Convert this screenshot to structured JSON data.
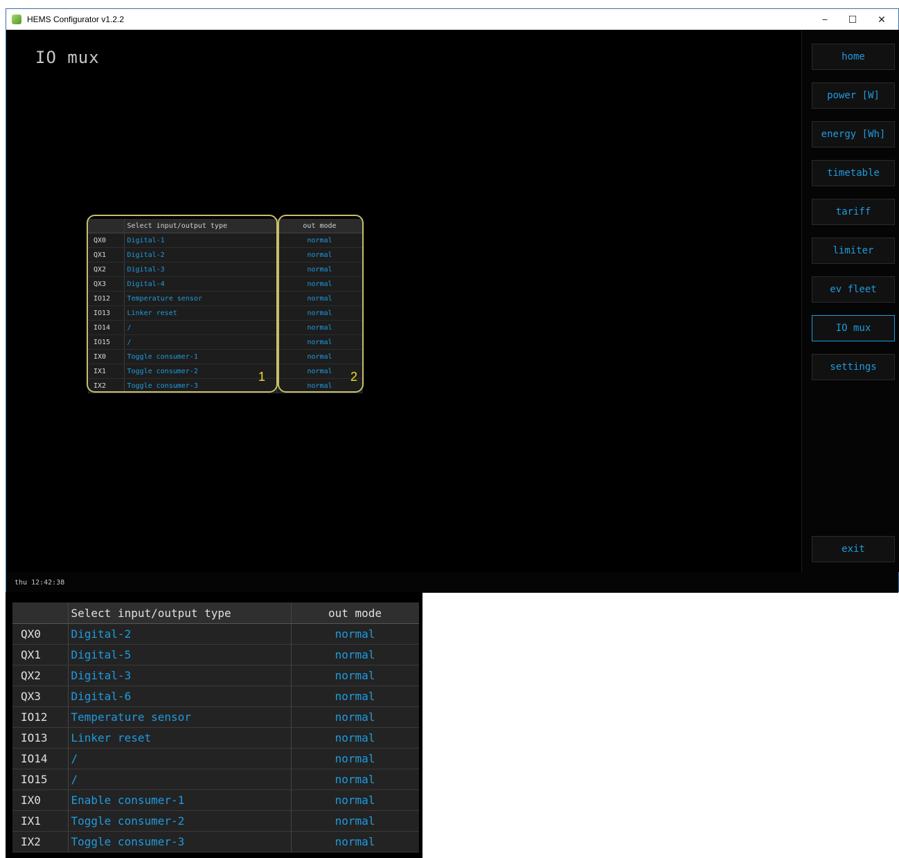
{
  "window": {
    "title": "HEMS Configurator v1.2.2",
    "controls": {
      "minimize": "−",
      "maximize": "☐",
      "close": "✕"
    }
  },
  "page": {
    "title": "IO mux"
  },
  "sidebar": {
    "items": [
      {
        "label": "home",
        "active": false
      },
      {
        "label": "power [W]",
        "active": false
      },
      {
        "label": "energy [Wh]",
        "active": false
      },
      {
        "label": "timetable",
        "active": false
      },
      {
        "label": "tariff",
        "active": false
      },
      {
        "label": "limiter",
        "active": false
      },
      {
        "label": "ev fleet",
        "active": false
      },
      {
        "label": "IO mux",
        "active": true
      },
      {
        "label": "settings",
        "active": false
      }
    ],
    "exit_label": "exit"
  },
  "status": {
    "time": "thu 12:42:38"
  },
  "small_table": {
    "headers": [
      "",
      "Select input/output type",
      "out mode"
    ],
    "rows": [
      {
        "pin": "QX0",
        "type": "Digital-1",
        "mode": "normal"
      },
      {
        "pin": "QX1",
        "type": "Digital-2",
        "mode": "normal"
      },
      {
        "pin": "QX2",
        "type": "Digital-3",
        "mode": "normal"
      },
      {
        "pin": "QX3",
        "type": "Digital-4",
        "mode": "normal"
      },
      {
        "pin": "IO12",
        "type": "Temperature sensor",
        "mode": "normal"
      },
      {
        "pin": "IO13",
        "type": "Linker reset",
        "mode": "normal"
      },
      {
        "pin": "IO14",
        "type": "/",
        "mode": "normal"
      },
      {
        "pin": "IO15",
        "type": "/",
        "mode": "normal"
      },
      {
        "pin": "IX0",
        "type": "Toggle consumer-1",
        "mode": "normal"
      },
      {
        "pin": "IX1",
        "type": "Toggle consumer-2",
        "mode": "normal"
      },
      {
        "pin": "IX2",
        "type": "Toggle consumer-3",
        "mode": "normal"
      }
    ],
    "callouts": [
      "1",
      "2"
    ]
  },
  "big_table": {
    "headers": [
      "",
      "Select input/output type",
      "out mode"
    ],
    "rows": [
      {
        "pin": "QX0",
        "type": "Digital-2",
        "mode": "normal"
      },
      {
        "pin": "QX1",
        "type": "Digital-5",
        "mode": "normal"
      },
      {
        "pin": "QX2",
        "type": "Digital-3",
        "mode": "normal"
      },
      {
        "pin": "QX3",
        "type": "Digital-6",
        "mode": "normal"
      },
      {
        "pin": "IO12",
        "type": "Temperature sensor",
        "mode": "normal"
      },
      {
        "pin": "IO13",
        "type": "Linker reset",
        "mode": "normal"
      },
      {
        "pin": "IO14",
        "type": "/",
        "mode": "normal"
      },
      {
        "pin": "IO15",
        "type": "/",
        "mode": "normal"
      },
      {
        "pin": "IX0",
        "type": "Enable consumer-1",
        "mode": "normal"
      },
      {
        "pin": "IX1",
        "type": "Toggle consumer-2",
        "mode": "normal"
      },
      {
        "pin": "IX2",
        "type": "Toggle consumer-3",
        "mode": "normal"
      }
    ]
  },
  "colors": {
    "accent": "#1e9be0",
    "callout": "#f0e020",
    "outline": "#c8c06a"
  }
}
